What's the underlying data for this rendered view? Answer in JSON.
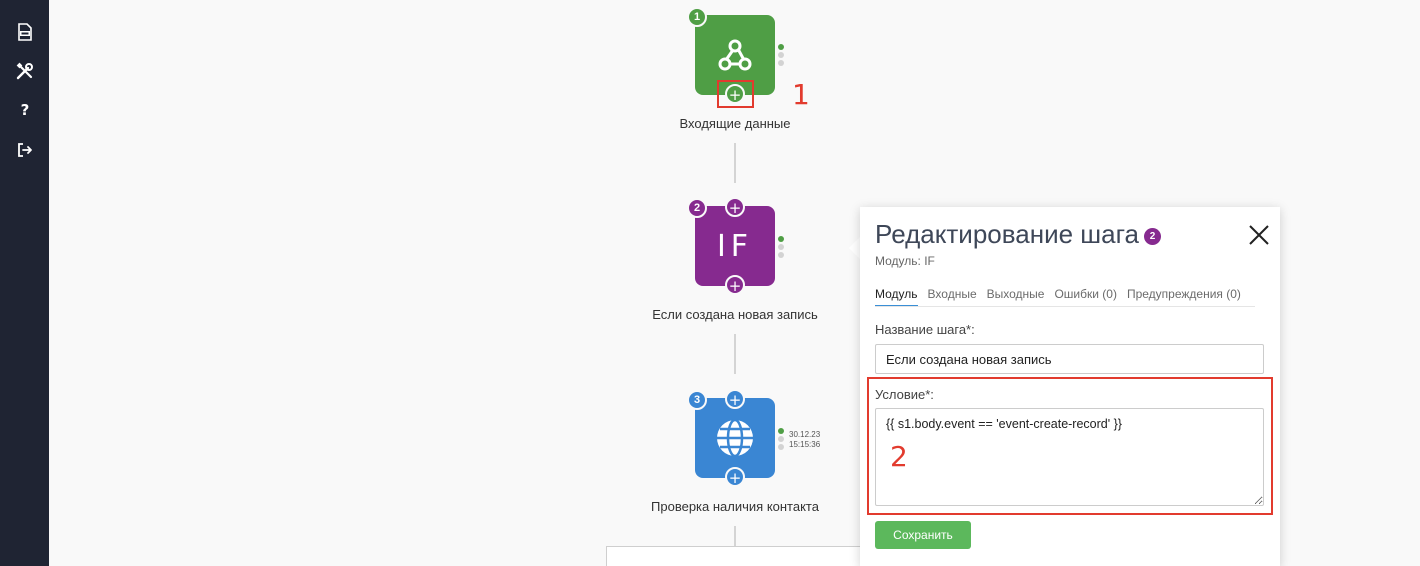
{
  "sidebar": {
    "items": [
      {
        "icon": "log-file-icon"
      },
      {
        "icon": "tools-icon"
      },
      {
        "icon": "help-icon",
        "glyph": "?"
      },
      {
        "icon": "logout-icon"
      }
    ]
  },
  "flow": {
    "nodes": [
      {
        "number": "1",
        "label": "Входящие данные",
        "color": "#4f9e45",
        "icon": "webhook-icon"
      },
      {
        "number": "2",
        "label": "Если создана новая запись",
        "color": "#862a8f",
        "icon": "if-icon",
        "icon_text": "IF"
      },
      {
        "number": "3",
        "label": "Проверка наличия контакта",
        "color": "#3a86d3",
        "icon": "globe-icon",
        "timestamp_date": "30.12.23",
        "timestamp_time": "15:15:36"
      }
    ],
    "add_glyph": "+"
  },
  "annotations": {
    "one": "1",
    "two": "2",
    "color": "#e23b2e"
  },
  "panel": {
    "title": "Редактирование шага",
    "step_badge": "2",
    "module_line": "Модуль: IF",
    "tabs": [
      {
        "label": "Модуль",
        "active": true
      },
      {
        "label": "Входные",
        "active": false
      },
      {
        "label": "Выходные",
        "active": false
      },
      {
        "label": "Ошибки (0)",
        "active": false
      },
      {
        "label": "Предупреждения (0)",
        "active": false
      }
    ],
    "step_name_label": "Название шага*:",
    "step_name_value": "Если создана новая запись",
    "condition_label": "Условие*:",
    "condition_value": "{{ s1.body.event == 'event-create-record' }}",
    "save_label": "Сохранить"
  },
  "colors": {
    "sidebar": "#1f2433",
    "save": "#5cb85c",
    "accent": "#3a8fd6"
  }
}
